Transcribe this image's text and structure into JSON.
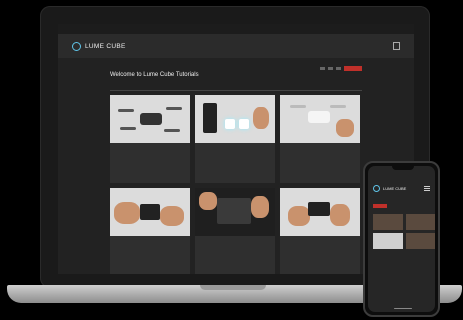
{
  "laptop": {
    "top_links": [
      "",
      "",
      ""
    ],
    "logo_text": "LUME CUBE",
    "nav": [
      "",
      "",
      "",
      "",
      "",
      "",
      ""
    ],
    "page_title": "Welcome to Lume Cube Tutorials",
    "section_label": "",
    "cards": [
      {
        "title": "",
        "desc": "",
        "meta": ""
      },
      {
        "title": "",
        "desc": "",
        "meta": ""
      },
      {
        "title": "",
        "desc": "",
        "meta": ""
      },
      {
        "title": "",
        "desc": "",
        "meta": ""
      },
      {
        "title": "",
        "desc": "",
        "meta": ""
      },
      {
        "title": "",
        "desc": "",
        "meta": ""
      }
    ]
  },
  "phone": {
    "logo_text": "LUME CUBE",
    "page_title": ""
  },
  "colors": {
    "accent": "#5fc4e8",
    "brand_red": "#c0302a"
  }
}
